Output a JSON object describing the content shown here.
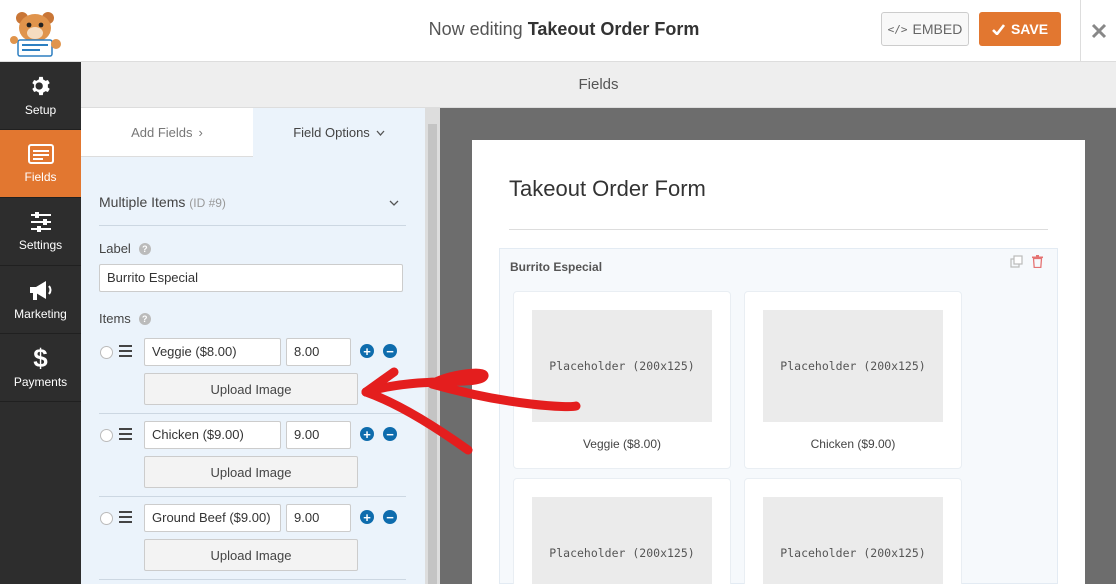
{
  "header": {
    "title_prefix": "Now editing",
    "title_name": "Takeout Order Form",
    "embed_label": "EMBED",
    "save_label": "SAVE",
    "accent_color": "#e27730"
  },
  "nav": {
    "items": [
      {
        "label": "Setup",
        "icon": "gear-icon"
      },
      {
        "label": "Fields",
        "icon": "fields-icon",
        "active": true
      },
      {
        "label": "Settings",
        "icon": "sliders-icon"
      },
      {
        "label": "Marketing",
        "icon": "megaphone-icon"
      },
      {
        "label": "Payments",
        "icon": "dollar-icon"
      }
    ]
  },
  "section_title": "Fields",
  "panel": {
    "tabs": {
      "add_fields": "Add Fields",
      "field_options": "Field Options"
    },
    "field_type": "Multiple Items",
    "field_id": "(ID #9)",
    "label_label": "Label",
    "label_value": "Burrito Especial",
    "items_label": "Items",
    "upload_label": "Upload Image",
    "items": [
      {
        "name": "Veggie ($8.00)",
        "price": "8.00"
      },
      {
        "name": "Chicken ($9.00)",
        "price": "9.00"
      },
      {
        "name": "Ground Beef ($9.00)",
        "price": "9.00"
      }
    ]
  },
  "preview": {
    "form_title": "Takeout Order Form",
    "field_label": "Burrito Especial",
    "placeholder_text": "Placeholder (200x125)",
    "choices": [
      "Veggie ($8.00)",
      "Chicken ($9.00)",
      "",
      ""
    ]
  }
}
